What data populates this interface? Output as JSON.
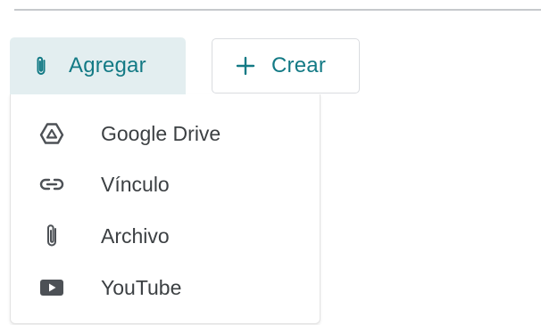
{
  "toolbar": {
    "agregar": {
      "label": "Agregar",
      "icon": "paperclip-icon"
    },
    "crear": {
      "label": "Crear",
      "icon": "plus-icon"
    }
  },
  "menu": {
    "items": [
      {
        "label": "Google Drive",
        "icon": "google-drive-icon"
      },
      {
        "label": "Vínculo",
        "icon": "link-icon"
      },
      {
        "label": "Archivo",
        "icon": "paperclip-icon"
      },
      {
        "label": "YouTube",
        "icon": "youtube-icon"
      }
    ]
  },
  "colors": {
    "accent": "#137a85",
    "agregar_bg": "#e3eef0",
    "menu_text": "#3c4043",
    "menu_icon": "#4d5156"
  }
}
